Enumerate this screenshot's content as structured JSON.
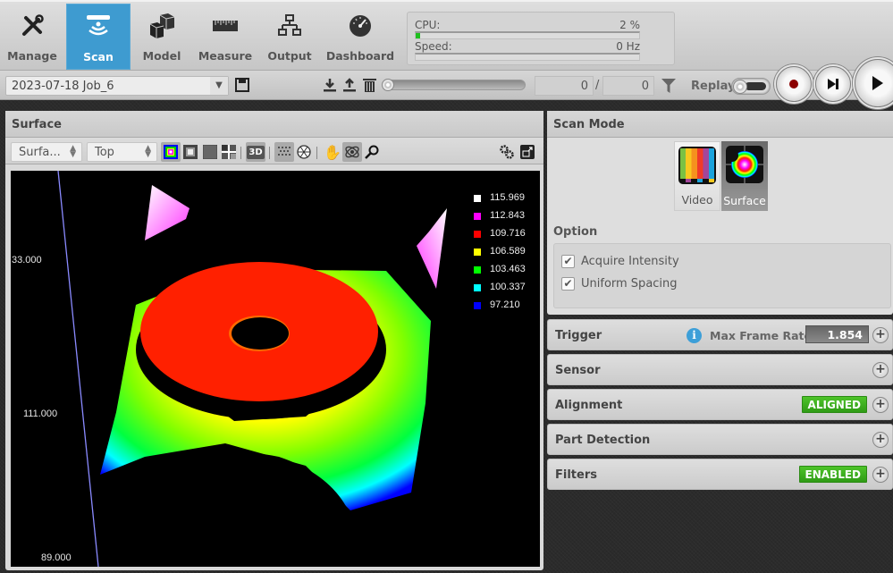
{
  "nav": {
    "tabs": [
      {
        "label": "Manage",
        "icon": "tools-icon",
        "active": false
      },
      {
        "label": "Scan",
        "icon": "scan-sensor-icon",
        "active": true
      },
      {
        "label": "Model",
        "icon": "cubes-icon",
        "active": false
      },
      {
        "label": "Measure",
        "icon": "ruler-icon",
        "active": false
      },
      {
        "label": "Output",
        "icon": "network-icon",
        "active": false
      },
      {
        "label": "Dashboard",
        "icon": "gauge-icon",
        "active": false
      }
    ]
  },
  "status": {
    "cpu_label": "CPU:",
    "cpu_value": "2 %",
    "cpu_fraction": 0.02,
    "speed_label": "Speed:",
    "speed_value": "0 Hz",
    "speed_fraction": 0
  },
  "toolbar": {
    "job": "2023-07-18 Job_6",
    "frame_current": "0",
    "frame_separator": "/",
    "frame_total": "0",
    "replay_label": "Replay",
    "replay_slider_position": 0
  },
  "surface_panel": {
    "title": "Surface",
    "view_select": "Surfa...",
    "orientation_select": "Top",
    "axis_labels": [
      "33.000",
      "111.000",
      "89.000"
    ],
    "legend": [
      {
        "value": "115.969",
        "color": "#ffffff"
      },
      {
        "value": "112.843",
        "color": "#ff00ff"
      },
      {
        "value": "109.716",
        "color": "#ff0000"
      },
      {
        "value": "106.589",
        "color": "#ffff00"
      },
      {
        "value": "103.463",
        "color": "#00ff00"
      },
      {
        "value": "100.337",
        "color": "#00ffff"
      },
      {
        "value": "97.210",
        "color": "#0000ff"
      }
    ]
  },
  "scan_mode": {
    "title": "Scan Mode",
    "modes": [
      {
        "label": "Video",
        "selected": false
      },
      {
        "label": "Surface",
        "selected": true
      }
    ],
    "option_label": "Option",
    "options": [
      {
        "label": "Acquire Intensity",
        "checked": true
      },
      {
        "label": "Uniform Spacing",
        "checked": true
      }
    ]
  },
  "sections": [
    {
      "title": "Trigger",
      "info": "i",
      "field_label": "Max Frame Rate:",
      "field_value": "1.854"
    },
    {
      "title": "Sensor"
    },
    {
      "title": "Alignment",
      "badge": "ALIGNED"
    },
    {
      "title": "Part Detection"
    },
    {
      "title": "Filters",
      "badge": "ENABLED"
    }
  ],
  "colors": {
    "accent": "#3e9bd0",
    "badge_green": "#3aae1f",
    "cpu_bar": "#1fc01f"
  }
}
